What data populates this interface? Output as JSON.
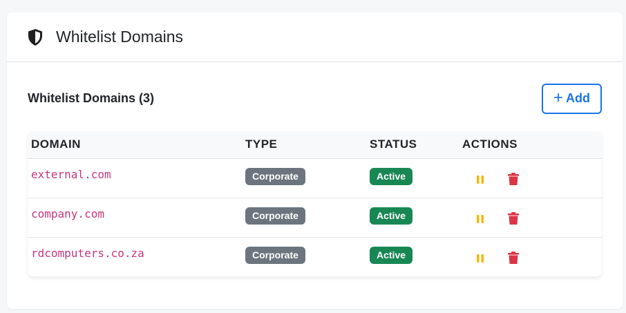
{
  "header": {
    "title": "Whitelist Domains",
    "icon": "shield-icon"
  },
  "section": {
    "title": "Whitelist Domains (3)",
    "add_label": "Add"
  },
  "table": {
    "columns": [
      "DOMAIN",
      "TYPE",
      "STATUS",
      "ACTIONS"
    ],
    "rows": [
      {
        "domain": "external.com",
        "type": "Corporate",
        "status": "Active"
      },
      {
        "domain": "company.com",
        "type": "Corporate",
        "status": "Active"
      },
      {
        "domain": "rdcomputers.co.za",
        "type": "Corporate",
        "status": "Active"
      }
    ]
  },
  "colors": {
    "accent": "#1a73e8",
    "domain_text": "#c7357c",
    "type_badge": "#6c757d",
    "status_badge": "#198754",
    "pause_icon": "#f5b50a",
    "delete_icon": "#dc3545"
  }
}
